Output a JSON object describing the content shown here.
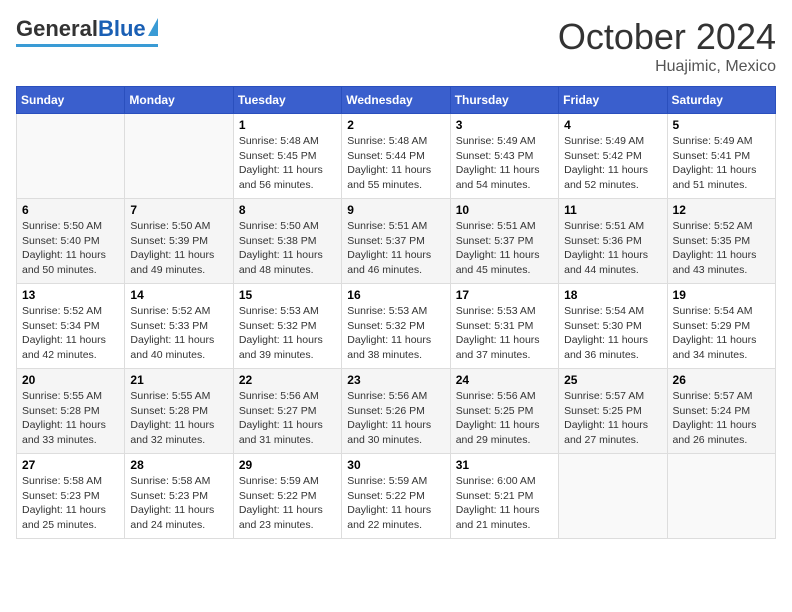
{
  "header": {
    "logo": {
      "general": "General",
      "blue": "Blue"
    },
    "month": "October 2024",
    "location": "Huajimic, Mexico"
  },
  "weekdays": [
    "Sunday",
    "Monday",
    "Tuesday",
    "Wednesday",
    "Thursday",
    "Friday",
    "Saturday"
  ],
  "weeks": [
    [
      {
        "day": "",
        "info": ""
      },
      {
        "day": "",
        "info": ""
      },
      {
        "day": "1",
        "info": "Sunrise: 5:48 AM\nSunset: 5:45 PM\nDaylight: 11 hours and 56 minutes."
      },
      {
        "day": "2",
        "info": "Sunrise: 5:48 AM\nSunset: 5:44 PM\nDaylight: 11 hours and 55 minutes."
      },
      {
        "day": "3",
        "info": "Sunrise: 5:49 AM\nSunset: 5:43 PM\nDaylight: 11 hours and 54 minutes."
      },
      {
        "day": "4",
        "info": "Sunrise: 5:49 AM\nSunset: 5:42 PM\nDaylight: 11 hours and 52 minutes."
      },
      {
        "day": "5",
        "info": "Sunrise: 5:49 AM\nSunset: 5:41 PM\nDaylight: 11 hours and 51 minutes."
      }
    ],
    [
      {
        "day": "6",
        "info": "Sunrise: 5:50 AM\nSunset: 5:40 PM\nDaylight: 11 hours and 50 minutes."
      },
      {
        "day": "7",
        "info": "Sunrise: 5:50 AM\nSunset: 5:39 PM\nDaylight: 11 hours and 49 minutes."
      },
      {
        "day": "8",
        "info": "Sunrise: 5:50 AM\nSunset: 5:38 PM\nDaylight: 11 hours and 48 minutes."
      },
      {
        "day": "9",
        "info": "Sunrise: 5:51 AM\nSunset: 5:37 PM\nDaylight: 11 hours and 46 minutes."
      },
      {
        "day": "10",
        "info": "Sunrise: 5:51 AM\nSunset: 5:37 PM\nDaylight: 11 hours and 45 minutes."
      },
      {
        "day": "11",
        "info": "Sunrise: 5:51 AM\nSunset: 5:36 PM\nDaylight: 11 hours and 44 minutes."
      },
      {
        "day": "12",
        "info": "Sunrise: 5:52 AM\nSunset: 5:35 PM\nDaylight: 11 hours and 43 minutes."
      }
    ],
    [
      {
        "day": "13",
        "info": "Sunrise: 5:52 AM\nSunset: 5:34 PM\nDaylight: 11 hours and 42 minutes."
      },
      {
        "day": "14",
        "info": "Sunrise: 5:52 AM\nSunset: 5:33 PM\nDaylight: 11 hours and 40 minutes."
      },
      {
        "day": "15",
        "info": "Sunrise: 5:53 AM\nSunset: 5:32 PM\nDaylight: 11 hours and 39 minutes."
      },
      {
        "day": "16",
        "info": "Sunrise: 5:53 AM\nSunset: 5:32 PM\nDaylight: 11 hours and 38 minutes."
      },
      {
        "day": "17",
        "info": "Sunrise: 5:53 AM\nSunset: 5:31 PM\nDaylight: 11 hours and 37 minutes."
      },
      {
        "day": "18",
        "info": "Sunrise: 5:54 AM\nSunset: 5:30 PM\nDaylight: 11 hours and 36 minutes."
      },
      {
        "day": "19",
        "info": "Sunrise: 5:54 AM\nSunset: 5:29 PM\nDaylight: 11 hours and 34 minutes."
      }
    ],
    [
      {
        "day": "20",
        "info": "Sunrise: 5:55 AM\nSunset: 5:28 PM\nDaylight: 11 hours and 33 minutes."
      },
      {
        "day": "21",
        "info": "Sunrise: 5:55 AM\nSunset: 5:28 PM\nDaylight: 11 hours and 32 minutes."
      },
      {
        "day": "22",
        "info": "Sunrise: 5:56 AM\nSunset: 5:27 PM\nDaylight: 11 hours and 31 minutes."
      },
      {
        "day": "23",
        "info": "Sunrise: 5:56 AM\nSunset: 5:26 PM\nDaylight: 11 hours and 30 minutes."
      },
      {
        "day": "24",
        "info": "Sunrise: 5:56 AM\nSunset: 5:25 PM\nDaylight: 11 hours and 29 minutes."
      },
      {
        "day": "25",
        "info": "Sunrise: 5:57 AM\nSunset: 5:25 PM\nDaylight: 11 hours and 27 minutes."
      },
      {
        "day": "26",
        "info": "Sunrise: 5:57 AM\nSunset: 5:24 PM\nDaylight: 11 hours and 26 minutes."
      }
    ],
    [
      {
        "day": "27",
        "info": "Sunrise: 5:58 AM\nSunset: 5:23 PM\nDaylight: 11 hours and 25 minutes."
      },
      {
        "day": "28",
        "info": "Sunrise: 5:58 AM\nSunset: 5:23 PM\nDaylight: 11 hours and 24 minutes."
      },
      {
        "day": "29",
        "info": "Sunrise: 5:59 AM\nSunset: 5:22 PM\nDaylight: 11 hours and 23 minutes."
      },
      {
        "day": "30",
        "info": "Sunrise: 5:59 AM\nSunset: 5:22 PM\nDaylight: 11 hours and 22 minutes."
      },
      {
        "day": "31",
        "info": "Sunrise: 6:00 AM\nSunset: 5:21 PM\nDaylight: 11 hours and 21 minutes."
      },
      {
        "day": "",
        "info": ""
      },
      {
        "day": "",
        "info": ""
      }
    ]
  ]
}
